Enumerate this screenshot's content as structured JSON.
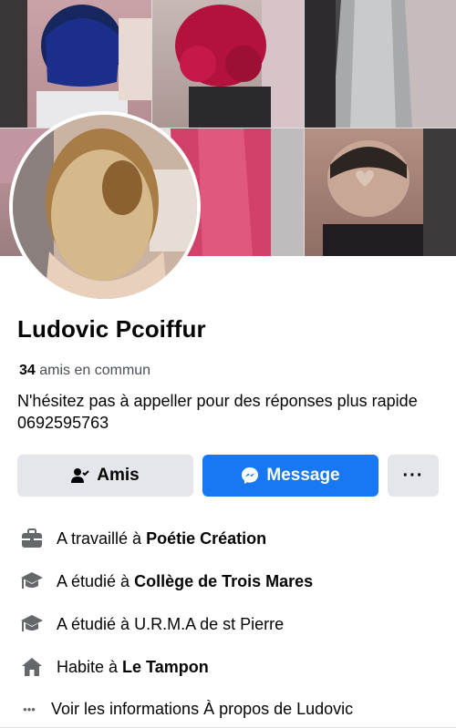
{
  "profile": {
    "name": "Ludovic Pcoiffur",
    "mutual_count": "34",
    "mutual_label": "amis en commun",
    "bio": "N'hésitez pas à appeller pour des réponses plus rapide 0692595763"
  },
  "actions": {
    "friends_label": "Amis",
    "message_label": "Message",
    "more_label": "···"
  },
  "info": {
    "work_prefix": "A travaillé à ",
    "work_place": "Poétie Création",
    "study1_prefix": "A étudié à ",
    "study1_place": "Collège de Trois Mares",
    "study2_text": "A étudié à U.R.M.A de st Pierre",
    "home_prefix": "Habite à ",
    "home_place": "Le Tampon",
    "about_label": "Voir les informations À propos de Ludovic",
    "about_dots": "•••"
  },
  "colors": {
    "accent": "#1877f2",
    "button_gray": "#e4e6eb",
    "text_secondary": "#4b4f56"
  },
  "icons": {
    "friends": "person-check-icon",
    "message": "messenger-icon",
    "more": "more-dots-icon",
    "work": "briefcase-icon",
    "study": "graduation-cap-icon",
    "home": "house-icon"
  }
}
